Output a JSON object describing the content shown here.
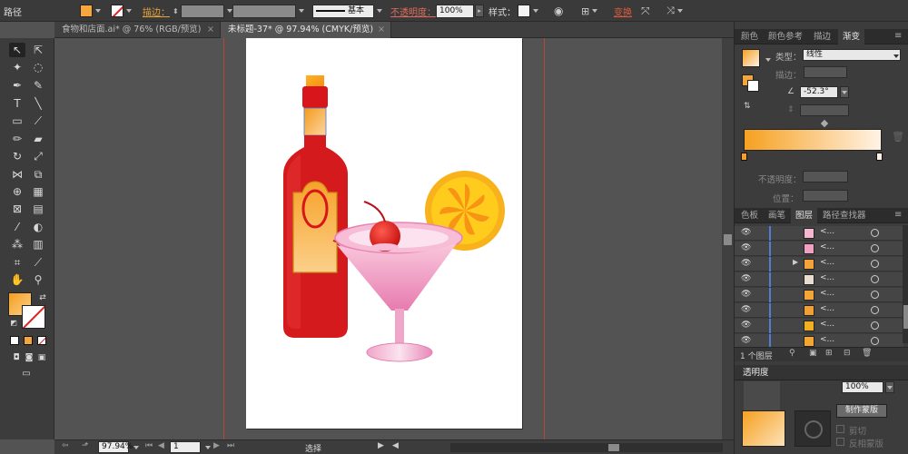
{
  "control_bar": {
    "object_type": "路径",
    "stroke_label": "描边：",
    "stroke_profile": "基本",
    "opacity_label": "不透明度：",
    "opacity_value": "100%",
    "style_label": "样式：",
    "transform_link": "变换",
    "fill_color": "#f6a63a"
  },
  "document_tabs": [
    {
      "label": "食物和店面.ai* @ 76% (RGB/预览)",
      "close": "×"
    },
    {
      "label": "未标题-37* @ 97.94% (CMYK/预览)",
      "close": "×"
    }
  ],
  "status_bar": {
    "zoom": "97.94%",
    "page": "1",
    "tool_status": "选择"
  },
  "gradient_panel": {
    "tabs": [
      "颜色",
      "颜色参考",
      "描边",
      "渐变"
    ],
    "type_label": "类型：",
    "type_value": "线性",
    "stroke_label": "描边：",
    "angle_value": "-52.3°",
    "opacity_label": "不透明度：",
    "position_label": "位置：",
    "gradient_start_color": "#f6a020",
    "gradient_end_color": "#fff3e6"
  },
  "layers_panel": {
    "tabs": [
      "色板",
      "画笔",
      "图层",
      "路径查找器"
    ],
    "rows": [
      {
        "name": "<...",
        "thumb_color": "#f3b8cf",
        "expand": ""
      },
      {
        "name": "<...",
        "thumb_color": "#f0a0c0",
        "expand": ""
      },
      {
        "name": "<...",
        "thumb_color": "#f5a23a",
        "expand": "▶"
      },
      {
        "name": "<...",
        "thumb_color": "#e8ddd0",
        "expand": ""
      },
      {
        "name": "<...",
        "thumb_color": "#f3a538",
        "expand": ""
      },
      {
        "name": "<...",
        "thumb_color": "#f0a030",
        "expand": ""
      },
      {
        "name": "<...",
        "thumb_color": "#f2b020",
        "expand": ""
      },
      {
        "name": "<...",
        "thumb_color": "#f5a630",
        "expand": ""
      }
    ],
    "layer_count": "1 个图层"
  },
  "transparency_panel": {
    "title": "透明度",
    "opacity_value": "100%",
    "make_mask_button": "制作蒙版",
    "clip_label": "剪切",
    "invert_mask_label": "反相蒙版"
  }
}
